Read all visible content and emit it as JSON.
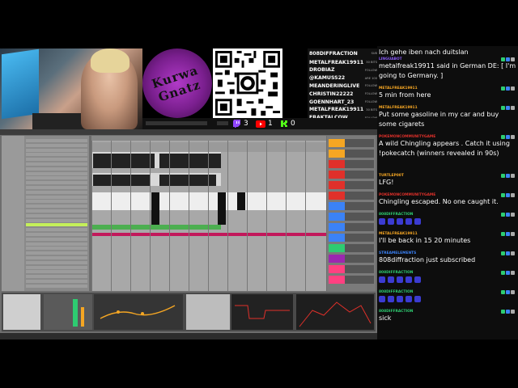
{
  "logo": {
    "text": "Kurwa Gnatz"
  },
  "followers": {
    "header_name": "808DIFFRACTION",
    "header_tag": "SUB",
    "rows": [
      {
        "name": "METALFREAK19911",
        "tag": "30 BITS"
      },
      {
        "name": "DROBIAZ",
        "tag": "FOLLOW"
      },
      {
        "name": "@KAMUSS22",
        "tag": "ARE 100"
      },
      {
        "name": "MEANDERINGLIVE",
        "tag": "FOLLOW"
      },
      {
        "name": "CHRISTIN22222",
        "tag": "FOLLOW"
      },
      {
        "name": "GOENNHART_23",
        "tag": "FOLLOW"
      },
      {
        "name": "METALFREAK19911",
        "tag": "30 BITS"
      },
      {
        "name": "FRAKTALCOW",
        "tag": "FOLLOW"
      },
      {
        "name": "METALFREAK19911",
        "tag": "30 BITS"
      }
    ]
  },
  "social": {
    "twitch_count": "3",
    "youtube_count": "1",
    "kick_count": "0"
  },
  "chat": {
    "messages": [
      {
        "user": "",
        "text": "Ich gehe iben nach duitslan",
        "color": "#ffffff"
      },
      {
        "user": "LINGUABOT",
        "text": "metalfreak19911 said in German DE: [ I'm going to Germany. ]",
        "color": "#8a5cf5"
      },
      {
        "user": "METALFREAK19911",
        "text": "5 min from here",
        "color": "#f5a623"
      },
      {
        "user": "METALFREAK19911",
        "text": "Put some gasoline in my car and buy some cigarets",
        "color": "#f5a623"
      },
      {
        "user": "POKEMONCOMMUNITYGAME",
        "text": "A wild Chingling appears . Catch it using !pokecatch (winners revealed in 90s)",
        "color": "#e0302a"
      },
      {
        "user": "TURTLEP00T",
        "text": "LFG!",
        "color": "#f5a623"
      },
      {
        "user": "POKEMONCOMMUNITYGAME",
        "text": "Chingling escaped. No one caught it.",
        "color": "#e0302a"
      },
      {
        "user": "808DIFFRACTION",
        "text": "",
        "color": "#2ecc71"
      },
      {
        "user": "METALFREAK19911",
        "text": "I'll be back in 15 20 minutes",
        "color": "#f5a623"
      },
      {
        "user": "STREAMELEMENTS",
        "text": "808diffraction just subscribed",
        "color": "#3b82f6"
      },
      {
        "user": "808DIFFRACTION",
        "text": "",
        "color": "#2ecc71"
      },
      {
        "user": "808DIFFRACTION",
        "text": "",
        "color": "#2ecc71"
      },
      {
        "user": "808DIFFRACTION",
        "text": "sick",
        "color": "#2ecc71"
      }
    ]
  },
  "colors": {
    "twitch": "#9146ff",
    "youtube": "#ff0000",
    "kick": "#53fc18",
    "accent_orange": "#f5a623",
    "accent_green": "#2ecc71"
  }
}
